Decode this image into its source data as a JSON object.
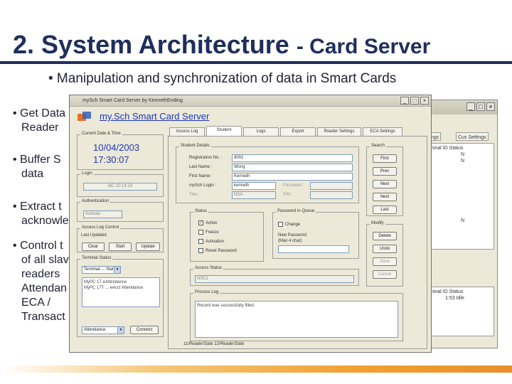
{
  "slide": {
    "title_main": "2. System Architecture",
    "title_sub": "- Card Server",
    "lead": "• Manipulation and synchronization of data in Smart Cards",
    "bullets": [
      {
        "lines": [
          "• Get Data",
          "Reader"
        ]
      },
      {
        "lines": [
          "• Buffer S",
          "data"
        ]
      },
      {
        "lines": [
          "• Extract t",
          "acknowle"
        ]
      },
      {
        "lines": [
          "• Control t",
          "of all slav",
          "readers",
          "Attendan",
          "ECA /",
          "Transact"
        ]
      }
    ]
  },
  "background_window": {
    "tabs": [
      "ngs",
      "Cus Settings"
    ],
    "panel1": {
      "header": "ninal ID   Status",
      "rows": [
        "N",
        "N"
      ]
    },
    "panel2": {
      "rows": [
        "N"
      ]
    },
    "panel3": {
      "header": "ninal ID   Status",
      "rows": [
        "1:53 Idle"
      ]
    }
  },
  "app": {
    "window_title": "mySch Smart Card Server by KennethEnding",
    "app_title": "my.Sch Smart Card Server",
    "tabs": [
      "Access Log",
      "Student",
      "Logs",
      "Export",
      "Reader Settings",
      "ECA Settings"
    ],
    "current": {
      "caption": "Current Date & Time",
      "date": "10/04/2003",
      "time": "17:30:07"
    },
    "login": {
      "caption": "Login",
      "value": "MC 10:14:24"
    },
    "authentication": {
      "caption": "Authentication",
      "value": "Activate"
    },
    "access_log_control": {
      "caption": "Access Log Control",
      "text": "Last Updated",
      "buttons": [
        "Clear",
        "Start",
        "Update"
      ]
    },
    "terminal_status": {
      "caption": "Terminal Status",
      "select_value": "Terminal ... Status",
      "lines": [
        "MyPC 1T eAttendance",
        "MyPC 17T ... eAcct Attendance"
      ]
    },
    "bottom_select": {
      "value": "Attendance",
      "button": "Connect"
    },
    "student_details": {
      "caption": "Student Details",
      "fields": [
        {
          "label": "Registration No. :",
          "value": "9001"
        },
        {
          "label": "Last Name :",
          "value": "Wong"
        },
        {
          "label": "First Name :",
          "value": "Kenneth"
        },
        {
          "label": "mySch Login :",
          "value": "kenneth"
        },
        {
          "label": "Title :",
          "value": "NSA"
        }
      ],
      "password_label": "Password :",
      "pin_label": "PIN :"
    },
    "status": {
      "caption": "Status",
      "options": [
        {
          "label": "Active",
          "checked": true
        },
        {
          "label": "Freeze",
          "checked": false
        },
        {
          "label": "Activation",
          "checked": false
        },
        {
          "label": "Reset Password",
          "checked": false
        }
      ]
    },
    "password_in_queue": {
      "caption": "Password in Queue",
      "option": "Change",
      "new_password_label": "New Password",
      "new_password_value": "(Max 4 char)"
    },
    "search": {
      "caption": "Search",
      "buttons": [
        "First",
        "Prev",
        "Next",
        "Next",
        "Last"
      ]
    },
    "modify": {
      "caption": "Modify",
      "buttons": [
        "Delete",
        "Undo",
        "Save",
        "Cancel"
      ]
    },
    "access_status": {
      "caption": "Access Status",
      "value": "NSC1"
    },
    "process_log": {
      "caption": "Process Log",
      "text": "Record was successfully filled."
    },
    "statusbar": "11/ReaderState    12/ReaderState"
  }
}
